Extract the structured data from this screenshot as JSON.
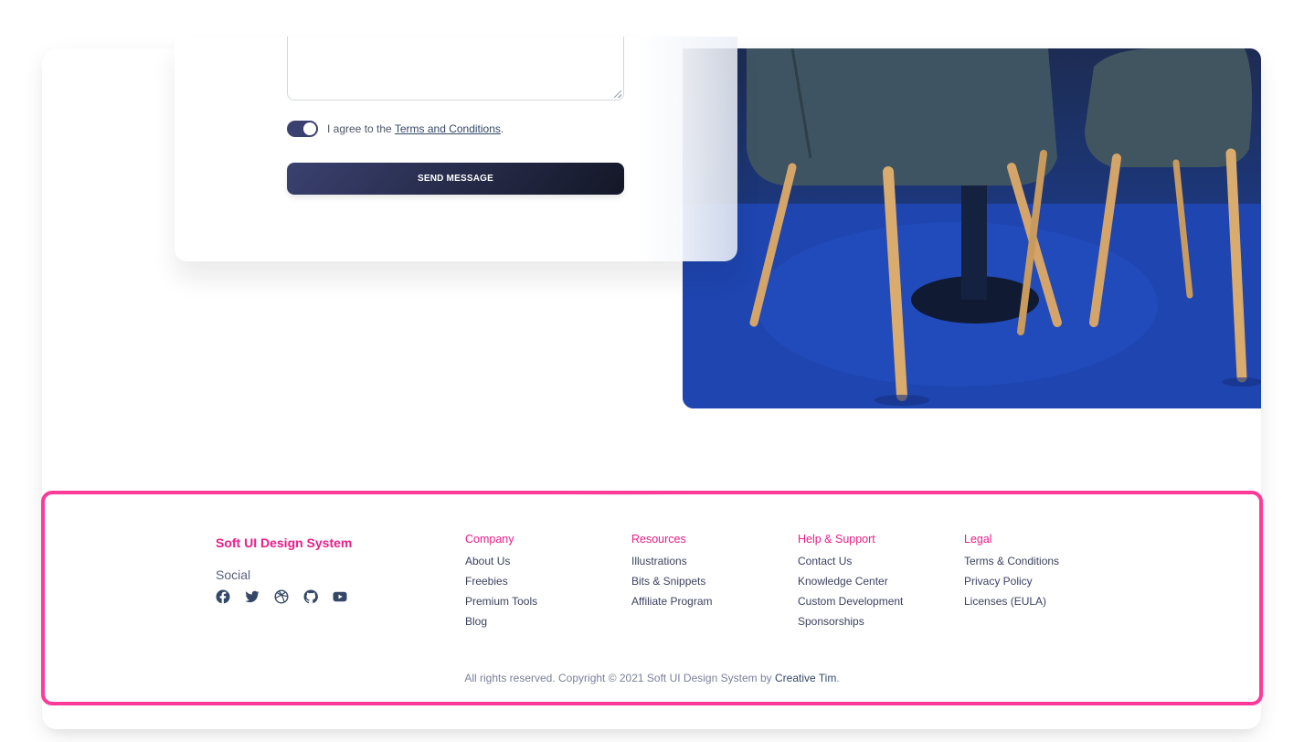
{
  "form": {
    "agree_prefix": "I agree to the",
    "terms_link": "Terms and Conditions",
    "agree_suffix": ".",
    "terms_toggle_on": true,
    "send_label": "SEND MESSAGE"
  },
  "footer": {
    "brand": "Soft UI Design System",
    "social_label": "Social",
    "social_icons": [
      "facebook-icon",
      "twitter-icon",
      "dribbble-icon",
      "github-icon",
      "youtube-icon"
    ],
    "columns": [
      {
        "title": "Company",
        "links": [
          "About Us",
          "Freebies",
          "Premium Tools",
          "Blog"
        ]
      },
      {
        "title": "Resources",
        "links": [
          "Illustrations",
          "Bits & Snippets",
          "Affiliate Program"
        ]
      },
      {
        "title": "Help & Support",
        "links": [
          "Contact Us",
          "Knowledge Center",
          "Custom Development",
          "Sponsorships"
        ]
      },
      {
        "title": "Legal",
        "links": [
          "Terms & Conditions",
          "Privacy Policy",
          "Licenses (EULA)"
        ]
      }
    ],
    "copyright_text": "All rights reserved. Copyright © 2021 Soft UI Design System by",
    "copyright_link": "Creative Tim",
    "copyright_end": "."
  },
  "colors": {
    "accent": "#e91e8c",
    "highlight_outline": "#ff3a99",
    "button_dark": "#3a416f",
    "text": "#344767"
  }
}
